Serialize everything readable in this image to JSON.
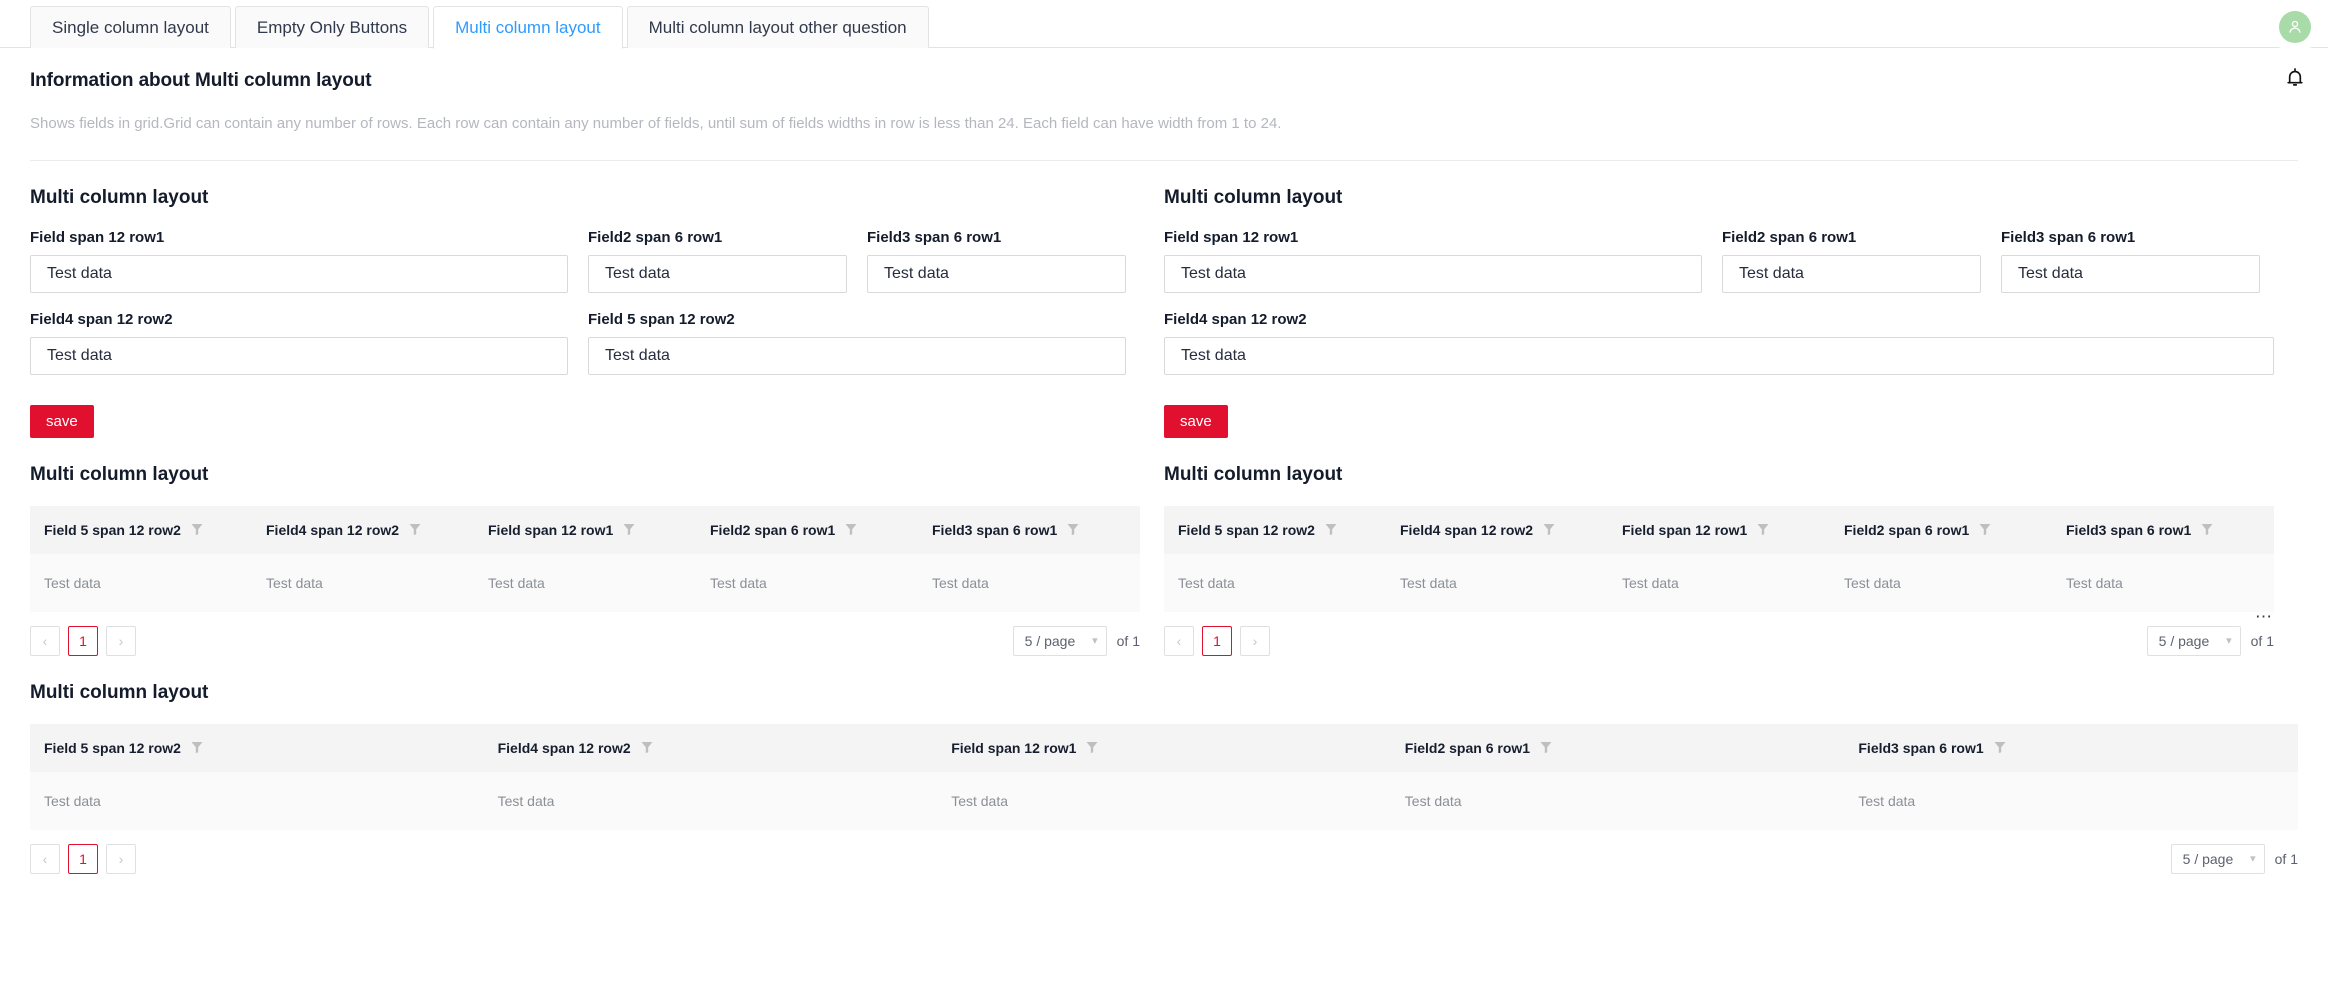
{
  "tabs": [
    {
      "label": "Single column layout",
      "active": false
    },
    {
      "label": "Empty Only Buttons",
      "active": false
    },
    {
      "label": "Multi column layout",
      "active": true
    },
    {
      "label": "Multi column layout other question",
      "active": false
    }
  ],
  "topbar": {
    "avatar_icon": "user-avatar-icon",
    "notification_icon": "bell-icon",
    "avatar_color": "#a8dba8"
  },
  "info": {
    "title": "Information about Multi column layout",
    "description": "Shows fields in grid.Grid can contain any number of rows. Each row can contain any number of fields, until sum of fields widths in row is less than 24. Each field can have width from 1 to 24."
  },
  "theme": {
    "accent": "#e0102e",
    "tab_active": "#2f9bff",
    "header_bg": "#f4f4f4",
    "row_bg": "#fafafa"
  },
  "form_left": {
    "title": "Multi column layout",
    "rows": [
      [
        {
          "label": "Field span 12 row1",
          "value": "Test data",
          "placeholder": "Test data",
          "span": "half"
        },
        {
          "label": "Field2 span 6 row1",
          "value": "Test data",
          "placeholder": "Test data",
          "span": "quarter"
        },
        {
          "label": "Field3 span 6 row1",
          "value": "Test data",
          "placeholder": "Test data",
          "span": "quarter"
        }
      ],
      [
        {
          "label": "Field4 span 12 row2",
          "value": "Test data",
          "placeholder": "Test data",
          "span": "half"
        },
        {
          "label": "Field 5 span 12 row2",
          "value": "Test data",
          "placeholder": "Test data",
          "span": "half"
        }
      ]
    ],
    "save_label": "save"
  },
  "form_right": {
    "title": "Multi column layout",
    "rows": [
      [
        {
          "label": "Field span 12 row1",
          "value": "Test data",
          "placeholder": "Test data",
          "span": "half"
        },
        {
          "label": "Field2 span 6 row1",
          "value": "Test data",
          "placeholder": "Test data",
          "span": "quarter"
        },
        {
          "label": "Field3 span 6 row1",
          "value": "Test data",
          "placeholder": "Test data",
          "span": "quarter"
        }
      ],
      [
        {
          "label": "Field4 span 12 row2",
          "value": "Test data",
          "placeholder": "Test data",
          "span": "full"
        }
      ]
    ],
    "save_label": "save"
  },
  "table_left": {
    "title": "Multi column layout",
    "columns": [
      "Field 5 span 12 row2",
      "Field4 span 12 row2",
      "Field span 12 row1",
      "Field2 span 6 row1",
      "Field3 span 6 row1"
    ],
    "rows": [
      [
        "Test data",
        "Test data",
        "Test data",
        "Test data",
        "Test data"
      ]
    ],
    "pagination": {
      "prev": "‹",
      "next": "›",
      "current_page": "1",
      "page_size": "5 / page",
      "total_label": "of 1"
    }
  },
  "table_right": {
    "title": "Multi column layout",
    "columns": [
      "Field 5 span 12 row2",
      "Field4 span 12 row2",
      "Field span 12 row1",
      "Field2 span 6 row1",
      "Field3 span 6 row1"
    ],
    "rows": [
      [
        "Test data",
        "Test data",
        "Test data",
        "Test data",
        "Test data"
      ]
    ],
    "pagination": {
      "prev": "‹",
      "next": "›",
      "current_page": "1",
      "page_size": "5 / page",
      "total_label": "of 1",
      "overflow": "⋯"
    }
  },
  "table_full": {
    "title": "Multi column layout",
    "columns": [
      "Field 5 span 12 row2",
      "Field4 span 12 row2",
      "Field span 12 row1",
      "Field2 span 6 row1",
      "Field3 span 6 row1"
    ],
    "rows": [
      [
        "Test data",
        "Test data",
        "Test data",
        "Test data",
        "Test data"
      ]
    ],
    "pagination": {
      "prev": "‹",
      "next": "›",
      "current_page": "1",
      "page_size": "5 / page",
      "total_label": "of 1"
    }
  }
}
